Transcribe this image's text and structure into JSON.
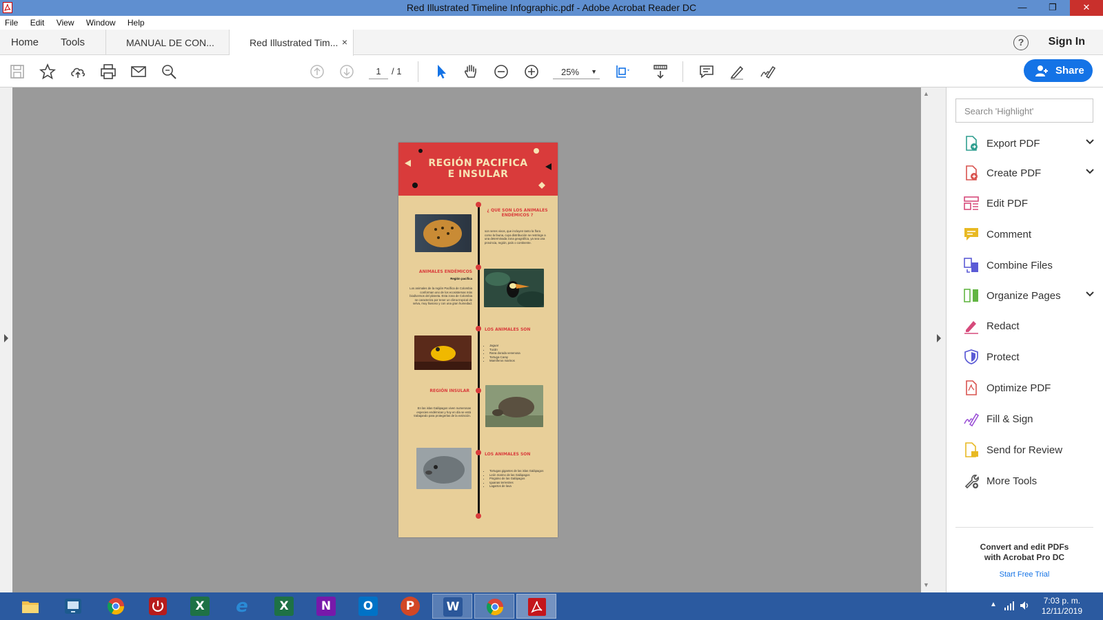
{
  "window": {
    "title": "Red Illustrated Timeline Infographic.pdf - Adobe Acrobat Reader DC"
  },
  "menu": [
    "File",
    "Edit",
    "View",
    "Window",
    "Help"
  ],
  "tabs": {
    "home": "Home",
    "tools": "Tools",
    "doc1": "MANUAL DE CON...",
    "doc2": "Red Illustrated Tim...",
    "close_glyph": "×"
  },
  "account": {
    "help_glyph": "?",
    "sign_in": "Sign In"
  },
  "toolbar": {
    "page_current": "1",
    "page_total": "/ 1",
    "zoom": "25%",
    "share": "Share"
  },
  "pdf": {
    "title_line1": "REGIÓN PACIFICA",
    "title_line2": "E INSULAR",
    "s1_head": "¿ QUE SON LOS ANIMALES ENDÉMICOS ?",
    "s1_text": "son seres vivos, que incluyen tanto la flora como la fauna, cuya distribución se restringe a una determinada zona geográfica, ya sea una provincia, región, país o continente.",
    "s2_head": "ANIMALES ENDÉMICOS",
    "s2_sub": "Región pacifica",
    "s2_text": "Los animales de la región Pacífica de Colombia conforman uno de los ecosistemas más biodiversos del planeta. Esta zona de Colombia se caracteriza por tener un clima tropical de selva, muy lluvioso y con una gran humedad.",
    "s3_head": "LOS ANIMALES SON",
    "s3_list": [
      "Jaguar",
      "Tucán",
      "Rana dorada venenosa",
      "Tortuga Caray",
      "Mamíferos marinos"
    ],
    "s4_head": "REGIÓN INSULAR",
    "s4_text": "En las islas Galápagos viven numerosas especies endémicas y hoy en día se está trabajando para protegerlas de la extinción.",
    "s5_head": "LOS ANIMALES SON",
    "s5_list": [
      "Tortugas gigantes de las islas Galápagos",
      "León marino de las Galápagos",
      "Pingüino de las Galápagos",
      "Iguanas terrestres",
      "Lagartos de lava"
    ]
  },
  "sidepanel": {
    "search_placeholder": "Search 'Highlight'",
    "tools": [
      {
        "label": "Export PDF",
        "color": "#2f9e8f"
      },
      {
        "label": "Create PDF",
        "color": "#d9534f"
      },
      {
        "label": "Edit PDF",
        "color": "#d64a7b"
      },
      {
        "label": "Comment",
        "color": "#e8b923"
      },
      {
        "label": "Combine Files",
        "color": "#5b5bd6"
      },
      {
        "label": "Organize Pages",
        "color": "#62b543"
      },
      {
        "label": "Redact",
        "color": "#d64a7b"
      },
      {
        "label": "Protect",
        "color": "#5b5bd6"
      },
      {
        "label": "Optimize PDF",
        "color": "#d9534f"
      },
      {
        "label": "Fill & Sign",
        "color": "#9a4fd6"
      },
      {
        "label": "Send for Review",
        "color": "#e8b923"
      },
      {
        "label": "More Tools",
        "color": "#555555"
      }
    ],
    "promo_line1": "Convert and edit PDFs",
    "promo_line2": "with Acrobat Pro DC",
    "promo_link": "Start Free Trial"
  },
  "taskbar": {
    "apps": [
      {
        "name": "file-explorer",
        "label": ""
      },
      {
        "name": "remote-desktop",
        "label": ""
      },
      {
        "name": "chrome",
        "label": ""
      },
      {
        "name": "power",
        "label": ""
      },
      {
        "name": "excel",
        "label": "X"
      },
      {
        "name": "internet-explorer",
        "label": "e"
      },
      {
        "name": "excel-2",
        "label": "X"
      },
      {
        "name": "onenote",
        "label": "N"
      },
      {
        "name": "outlook",
        "label": "O"
      },
      {
        "name": "powerpoint",
        "label": "P"
      },
      {
        "name": "word",
        "label": "W"
      },
      {
        "name": "chrome-2",
        "label": ""
      },
      {
        "name": "acrobat",
        "label": ""
      }
    ],
    "time": "7:03 p. m.",
    "date": "12/11/2019"
  }
}
